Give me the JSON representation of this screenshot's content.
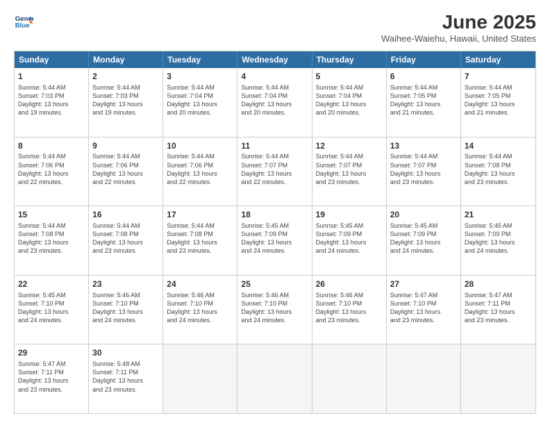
{
  "header": {
    "logo_line1": "General",
    "logo_line2": "Blue",
    "month_title": "June 2025",
    "location": "Waihee-Waiehu, Hawaii, United States"
  },
  "weekdays": [
    "Sunday",
    "Monday",
    "Tuesday",
    "Wednesday",
    "Thursday",
    "Friday",
    "Saturday"
  ],
  "rows": [
    [
      {
        "day": "1",
        "lines": [
          "Sunrise: 5:44 AM",
          "Sunset: 7:03 PM",
          "Daylight: 13 hours",
          "and 19 minutes."
        ]
      },
      {
        "day": "2",
        "lines": [
          "Sunrise: 5:44 AM",
          "Sunset: 7:03 PM",
          "Daylight: 13 hours",
          "and 19 minutes."
        ]
      },
      {
        "day": "3",
        "lines": [
          "Sunrise: 5:44 AM",
          "Sunset: 7:04 PM",
          "Daylight: 13 hours",
          "and 20 minutes."
        ]
      },
      {
        "day": "4",
        "lines": [
          "Sunrise: 5:44 AM",
          "Sunset: 7:04 PM",
          "Daylight: 13 hours",
          "and 20 minutes."
        ]
      },
      {
        "day": "5",
        "lines": [
          "Sunrise: 5:44 AM",
          "Sunset: 7:04 PM",
          "Daylight: 13 hours",
          "and 20 minutes."
        ]
      },
      {
        "day": "6",
        "lines": [
          "Sunrise: 5:44 AM",
          "Sunset: 7:05 PM",
          "Daylight: 13 hours",
          "and 21 minutes."
        ]
      },
      {
        "day": "7",
        "lines": [
          "Sunrise: 5:44 AM",
          "Sunset: 7:05 PM",
          "Daylight: 13 hours",
          "and 21 minutes."
        ]
      }
    ],
    [
      {
        "day": "8",
        "lines": [
          "Sunrise: 5:44 AM",
          "Sunset: 7:06 PM",
          "Daylight: 13 hours",
          "and 22 minutes."
        ]
      },
      {
        "day": "9",
        "lines": [
          "Sunrise: 5:44 AM",
          "Sunset: 7:06 PM",
          "Daylight: 13 hours",
          "and 22 minutes."
        ]
      },
      {
        "day": "10",
        "lines": [
          "Sunrise: 5:44 AM",
          "Sunset: 7:06 PM",
          "Daylight: 13 hours",
          "and 22 minutes."
        ]
      },
      {
        "day": "11",
        "lines": [
          "Sunrise: 5:44 AM",
          "Sunset: 7:07 PM",
          "Daylight: 13 hours",
          "and 22 minutes."
        ]
      },
      {
        "day": "12",
        "lines": [
          "Sunrise: 5:44 AM",
          "Sunset: 7:07 PM",
          "Daylight: 13 hours",
          "and 23 minutes."
        ]
      },
      {
        "day": "13",
        "lines": [
          "Sunrise: 5:44 AM",
          "Sunset: 7:07 PM",
          "Daylight: 13 hours",
          "and 23 minutes."
        ]
      },
      {
        "day": "14",
        "lines": [
          "Sunrise: 5:44 AM",
          "Sunset: 7:08 PM",
          "Daylight: 13 hours",
          "and 23 minutes."
        ]
      }
    ],
    [
      {
        "day": "15",
        "lines": [
          "Sunrise: 5:44 AM",
          "Sunset: 7:08 PM",
          "Daylight: 13 hours",
          "and 23 minutes."
        ]
      },
      {
        "day": "16",
        "lines": [
          "Sunrise: 5:44 AM",
          "Sunset: 7:08 PM",
          "Daylight: 13 hours",
          "and 23 minutes."
        ]
      },
      {
        "day": "17",
        "lines": [
          "Sunrise: 5:44 AM",
          "Sunset: 7:08 PM",
          "Daylight: 13 hours",
          "and 23 minutes."
        ]
      },
      {
        "day": "18",
        "lines": [
          "Sunrise: 5:45 AM",
          "Sunset: 7:09 PM",
          "Daylight: 13 hours",
          "and 24 minutes."
        ]
      },
      {
        "day": "19",
        "lines": [
          "Sunrise: 5:45 AM",
          "Sunset: 7:09 PM",
          "Daylight: 13 hours",
          "and 24 minutes."
        ]
      },
      {
        "day": "20",
        "lines": [
          "Sunrise: 5:45 AM",
          "Sunset: 7:09 PM",
          "Daylight: 13 hours",
          "and 24 minutes."
        ]
      },
      {
        "day": "21",
        "lines": [
          "Sunrise: 5:45 AM",
          "Sunset: 7:09 PM",
          "Daylight: 13 hours",
          "and 24 minutes."
        ]
      }
    ],
    [
      {
        "day": "22",
        "lines": [
          "Sunrise: 5:45 AM",
          "Sunset: 7:10 PM",
          "Daylight: 13 hours",
          "and 24 minutes."
        ]
      },
      {
        "day": "23",
        "lines": [
          "Sunrise: 5:46 AM",
          "Sunset: 7:10 PM",
          "Daylight: 13 hours",
          "and 24 minutes."
        ]
      },
      {
        "day": "24",
        "lines": [
          "Sunrise: 5:46 AM",
          "Sunset: 7:10 PM",
          "Daylight: 13 hours",
          "and 24 minutes."
        ]
      },
      {
        "day": "25",
        "lines": [
          "Sunrise: 5:46 AM",
          "Sunset: 7:10 PM",
          "Daylight: 13 hours",
          "and 24 minutes."
        ]
      },
      {
        "day": "26",
        "lines": [
          "Sunrise: 5:46 AM",
          "Sunset: 7:10 PM",
          "Daylight: 13 hours",
          "and 23 minutes."
        ]
      },
      {
        "day": "27",
        "lines": [
          "Sunrise: 5:47 AM",
          "Sunset: 7:10 PM",
          "Daylight: 13 hours",
          "and 23 minutes."
        ]
      },
      {
        "day": "28",
        "lines": [
          "Sunrise: 5:47 AM",
          "Sunset: 7:11 PM",
          "Daylight: 13 hours",
          "and 23 minutes."
        ]
      }
    ],
    [
      {
        "day": "29",
        "lines": [
          "Sunrise: 5:47 AM",
          "Sunset: 7:11 PM",
          "Daylight: 13 hours",
          "and 23 minutes."
        ]
      },
      {
        "day": "30",
        "lines": [
          "Sunrise: 5:48 AM",
          "Sunset: 7:11 PM",
          "Daylight: 13 hours",
          "and 23 minutes."
        ]
      },
      {
        "day": "",
        "lines": []
      },
      {
        "day": "",
        "lines": []
      },
      {
        "day": "",
        "lines": []
      },
      {
        "day": "",
        "lines": []
      },
      {
        "day": "",
        "lines": []
      }
    ]
  ]
}
